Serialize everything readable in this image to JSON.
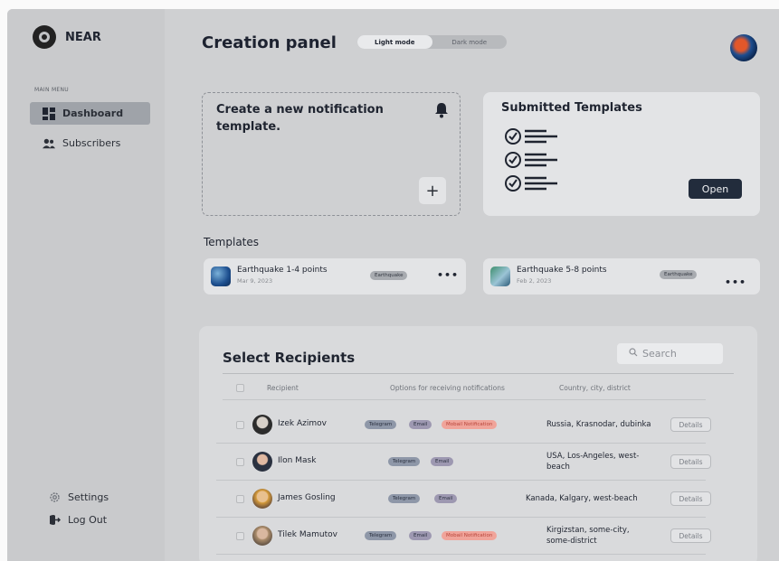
{
  "sidebar": {
    "brand": "NEAR",
    "menu_label": "MAIN MENU",
    "items": [
      {
        "label": "Dashboard",
        "icon": "grid-icon",
        "active": true
      },
      {
        "label": "Subscribers",
        "icon": "users-icon",
        "active": false
      }
    ],
    "bottom_items": [
      {
        "label": "Settings",
        "icon": "gear-icon"
      },
      {
        "label": "Log Out",
        "icon": "logout-icon"
      }
    ]
  },
  "header": {
    "title": "Creation panel",
    "modes": [
      "Light mode",
      "Dark mode"
    ],
    "selected_mode": "Light mode"
  },
  "new_card": {
    "title": "Create a new notification template.",
    "add_label": "+"
  },
  "submitted_card": {
    "title": "Submitted Templates",
    "open_label": "Open"
  },
  "templates": {
    "heading": "Templates",
    "items": [
      {
        "name": "Earthquake 1-4 points",
        "date": "Mar 9, 2023",
        "tag": "Earthquake",
        "more": "•••"
      },
      {
        "name": "Earthquake 5-8 points",
        "date": "Feb 2, 2023",
        "tag": "Earthquake",
        "more": "•••"
      }
    ]
  },
  "recipients": {
    "title": "Select Recipients",
    "search_placeholder": "Search",
    "columns": [
      "Recipient",
      "Options for receiving notifications",
      "Country, city, district"
    ],
    "rows": [
      {
        "name": "Izek Azimov",
        "options": [
          "Telegram",
          "Email",
          "Mobail Notification"
        ],
        "location": "Russia, Krasnodar, dubinka",
        "action": "Details"
      },
      {
        "name": "Ilon Mask",
        "options": [
          "Telegram",
          "Email"
        ],
        "location": "USA, Los-Angeles, west-beach",
        "action": "Details"
      },
      {
        "name": "James Gosling",
        "options": [
          "Telegram",
          "Email"
        ],
        "location": "Kanada, Kalgary, west-beach",
        "action": "Details"
      },
      {
        "name": "Tilek Mamutov",
        "options": [
          "Telegram",
          "Email",
          "Mobail Notification"
        ],
        "location": "Kirgizstan, some-city, some-district",
        "action": "Details"
      }
    ]
  },
  "colors": {
    "accent": "#222c3c",
    "telegram_pill": "#8e97a8",
    "email_pill": "#9d98b1",
    "mobile_pill": "#f0a49a"
  }
}
